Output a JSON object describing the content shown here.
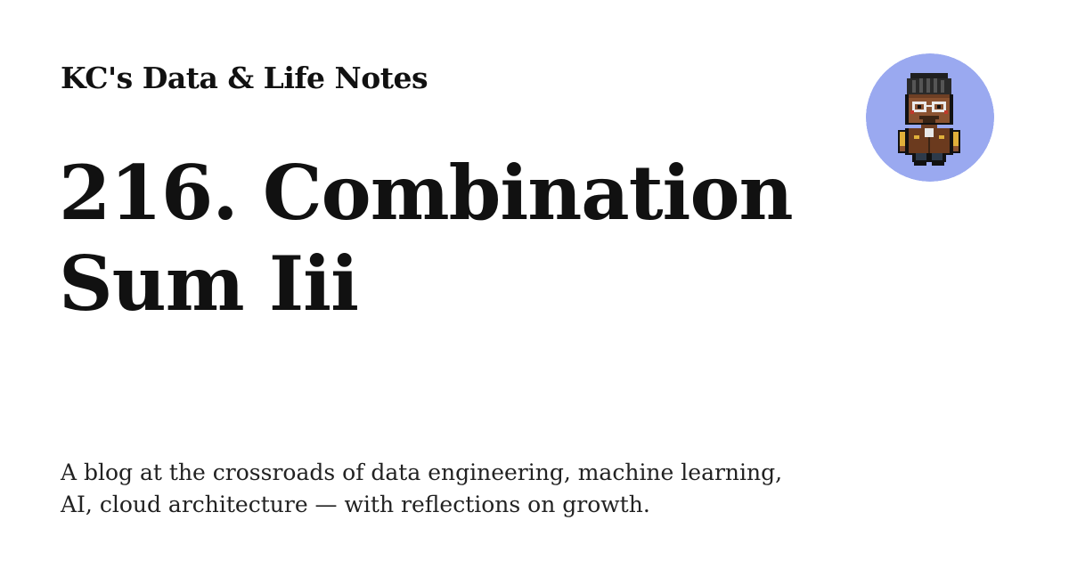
{
  "site": {
    "name": "KC's Data & Life Notes",
    "description": "A blog at the crossroads of data engineering, machine learning, AI, cloud architecture — with reflections on growth."
  },
  "post": {
    "title": "216. Combination Sum Iii"
  },
  "avatar": {
    "icon": "pixel-art-person-icon",
    "background_color": "#9aa9f0"
  }
}
